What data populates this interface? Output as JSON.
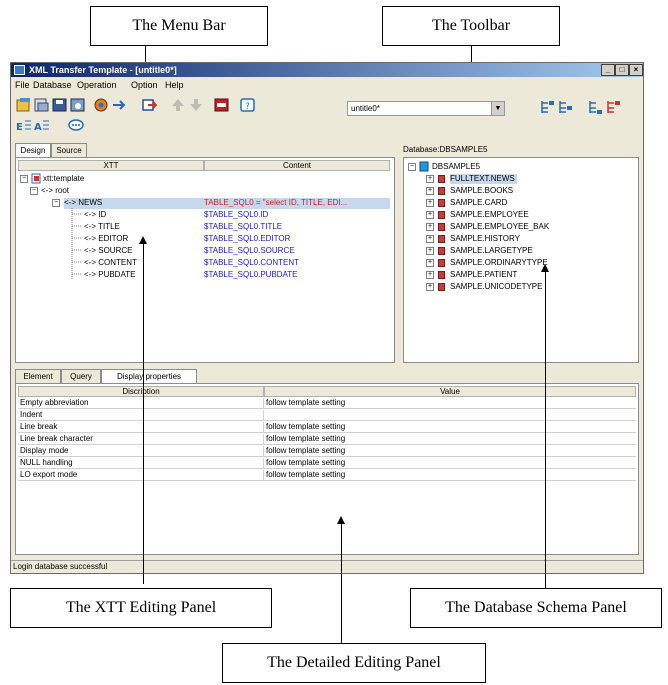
{
  "callouts": {
    "menu_bar": "The Menu Bar",
    "toolbar": "The Toolbar",
    "xtt_panel": "The XTT Editing Panel",
    "db_schema_panel": "The Database Schema Panel",
    "detailed_panel": "The Detailed Editing Panel"
  },
  "window": {
    "title": "XML Transfer Template - [untitle0*]",
    "controls": [
      "_",
      "□",
      "×"
    ]
  },
  "menu": [
    "File",
    "Database",
    "Operation",
    "Option",
    "Help"
  ],
  "toolbar": {
    "combo_value": "untitle0*"
  },
  "xtt_panel": {
    "tabs": [
      "Design",
      "Source"
    ],
    "columns": [
      "XTT",
      "Content"
    ],
    "tree": {
      "root_label": "xtt:template",
      "root_child": "<-> root",
      "news_label": "<-> NEWS",
      "news_content": "TABLE_SQL0 = \"select ID, TITLE, EDI...",
      "fields": [
        {
          "label": "<-> ID",
          "content": "$TABLE_SQL0.ID"
        },
        {
          "label": "<-> TITLE",
          "content": "$TABLE_SQL0.TITLE"
        },
        {
          "label": "<-> EDITOR",
          "content": "$TABLE_SQL0.EDITOR"
        },
        {
          "label": "<-> SOURCE",
          "content": "$TABLE_SQL0.SOURCE"
        },
        {
          "label": "<-> CONTENT",
          "content": "$TABLE_SQL0.CONTENT"
        },
        {
          "label": "<-> PUBDATE",
          "content": "$TABLE_SQL0.PUBDATE"
        }
      ]
    }
  },
  "db_panel": {
    "header": "Database:DBSAMPLE5",
    "root": "DBSAMPLE5",
    "tables": [
      "FULLTEXT.NEWS",
      "SAMPLE.BOOKS",
      "SAMPLE.CARD",
      "SAMPLE.EMPLOYEE",
      "SAMPLE.EMPLOYEE_BAK",
      "SAMPLE.HISTORY",
      "SAMPLE.LARGETYPE",
      "SAMPLE.ORDINARYTYPE",
      "SAMPLE.PATIENT",
      "SAMPLE.UNICODETYPE"
    ]
  },
  "detail_panel": {
    "tabs": [
      "Element",
      "Query",
      "Display properties"
    ],
    "columns": [
      "Discription",
      "Value"
    ],
    "rows": [
      {
        "name": "Empty abbreviation",
        "value": "follow template setting"
      },
      {
        "name": "Indent",
        "value": ""
      },
      {
        "name": "Line break",
        "value": "follow template setting"
      },
      {
        "name": "Line break character",
        "value": "follow template setting"
      },
      {
        "name": "Display mode",
        "value": "follow template setting"
      },
      {
        "name": "NULL handling",
        "value": "follow template setting"
      },
      {
        "name": "LO export mode",
        "value": "follow template setting"
      }
    ]
  },
  "status": "Login database successful"
}
